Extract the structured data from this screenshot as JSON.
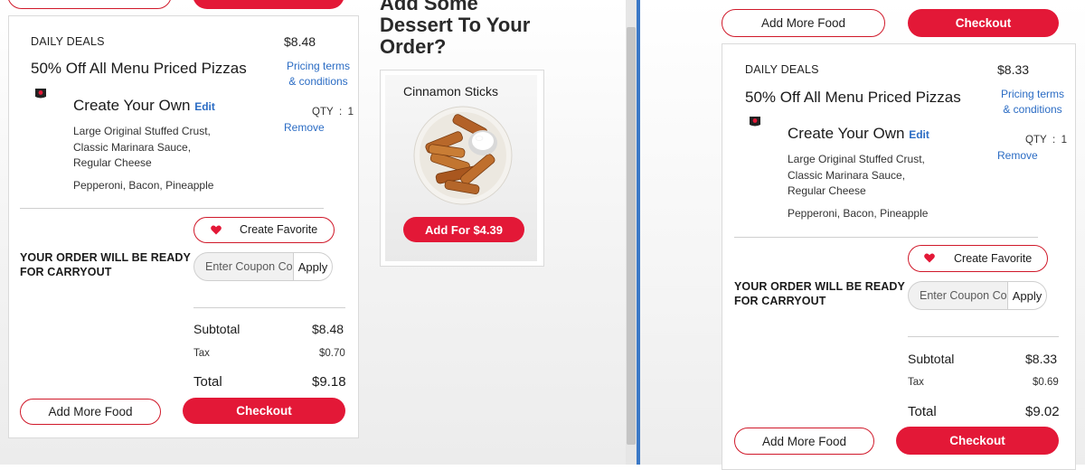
{
  "left": {
    "header_add_more": "",
    "header_checkout": "",
    "card": {
      "daily_deals": "DAILY DEALS",
      "deal_price": "$8.48",
      "deal_name": "50% Off All Menu Priced Pizzas",
      "pricing_terms": "Pricing terms & conditions",
      "item_name": "Create Your Own",
      "edit": "Edit",
      "qty_label": "QTY",
      "qty_sep": ":",
      "qty_value": "1",
      "remove": "Remove",
      "details": [
        "Large Original Stuffed Crust,",
        "Classic Marinara Sauce,",
        "Regular Cheese"
      ],
      "toppings": "Pepperoni, Bacon, Pineapple",
      "create_favorite": "Create Favorite",
      "ready_line1": "YOUR ORDER WILL BE READY",
      "ready_line2": "FOR CARRYOUT",
      "coupon_placeholder": "Enter Coupon Code",
      "apply": "Apply",
      "subtotal_label": "Subtotal",
      "subtotal_value": "$8.48",
      "tax_label": "Tax",
      "tax_value": "$0.70",
      "total_label": "Total",
      "total_value": "$9.18",
      "add_more_food": "Add More Food",
      "checkout": "Checkout"
    }
  },
  "upsell": {
    "heading_line1": "Add Some",
    "heading_line2": "Dessert To Your",
    "heading_line3": "Order?",
    "product_name": "Cinnamon Sticks",
    "add_button": "Add For $4.39"
  },
  "right": {
    "header_add_more": "Add More Food",
    "header_checkout": "Checkout",
    "card": {
      "daily_deals": "DAILY DEALS",
      "deal_price": "$8.33",
      "deal_name": "50% Off All Menu Priced Pizzas",
      "pricing_terms": "Pricing terms & conditions",
      "item_name": "Create Your Own",
      "edit": "Edit",
      "qty_label": "QTY",
      "qty_sep": ":",
      "qty_value": "1",
      "remove": "Remove",
      "details": [
        "Large Original Stuffed Crust,",
        "Classic Marinara Sauce,",
        "Regular Cheese"
      ],
      "toppings": "Pepperoni, Bacon, Pineapple",
      "create_favorite": "Create Favorite",
      "ready_line1": "YOUR ORDER WILL BE READY",
      "ready_line2": "FOR CARRYOUT",
      "coupon_placeholder": "Enter Coupon Code",
      "apply": "Apply",
      "subtotal_label": "Subtotal",
      "subtotal_value": "$8.33",
      "tax_label": "Tax",
      "tax_value": "$0.69",
      "total_label": "Total",
      "total_value": "$9.02",
      "add_more_food": "Add More Food",
      "checkout": "Checkout"
    }
  },
  "colors": {
    "brand_red": "#e31837",
    "link_blue": "#2b6cc4",
    "window_border": "#3b78c6"
  },
  "icons": [
    "pizza-box-icon",
    "heart-icon",
    "cinnamon-sticks-image"
  ]
}
